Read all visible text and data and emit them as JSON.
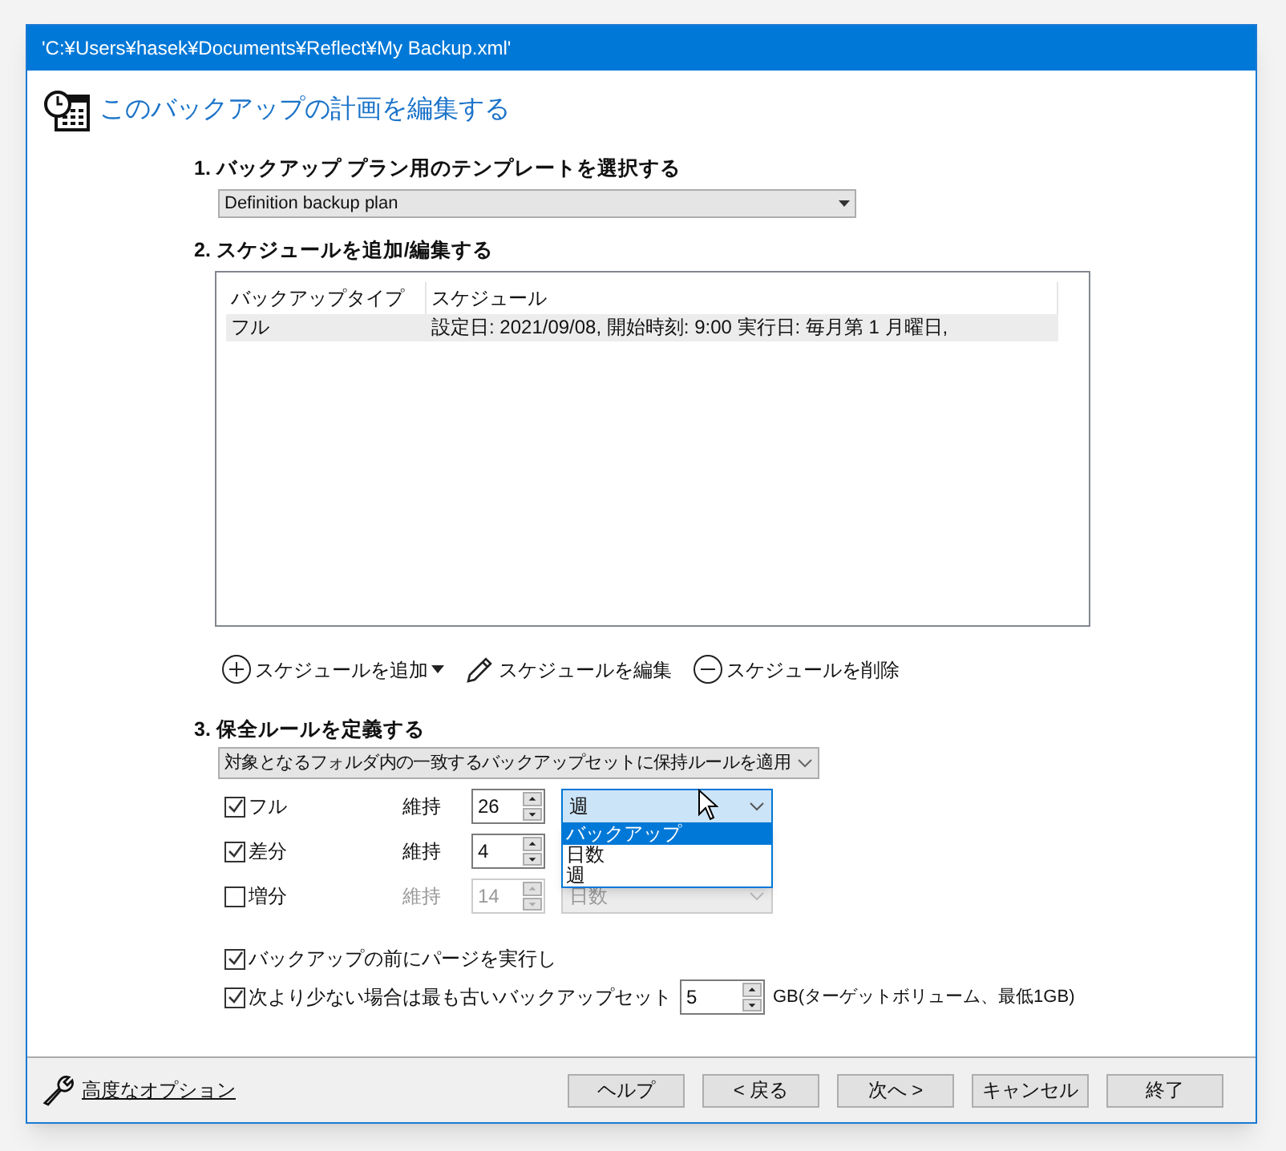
{
  "window": {
    "title": "'C:¥Users¥hasek¥Documents¥Reflect¥My Backup.xml'"
  },
  "heading": "このバックアップの計画を編集する",
  "section1": {
    "title": "1. バックアップ プラン用のテンプレートを選択する",
    "template": "Definition backup plan"
  },
  "section2": {
    "title": "2. スケジュールを追加/編集する",
    "table": {
      "columns": [
        "バックアップタイプ",
        "スケジュール"
      ],
      "rows": [
        {
          "cells": [
            "フル",
            "設定日: 2021/09/08, 開始時刻: 9:00  実行日: 毎月第 1 月曜日,"
          ],
          "selected": true
        }
      ]
    },
    "buttons": [
      {
        "kind": "add",
        "label": "スケジュールを追加"
      },
      {
        "kind": "edit",
        "label": "スケジュールを編集"
      },
      {
        "kind": "delete",
        "label": "スケジュールを削除"
      }
    ]
  },
  "section3": {
    "title": "3. 保全ルールを定義する",
    "policy": "対象となるフォルダ内の一致するバックアップセットに保持ルールを適用",
    "rules": [
      {
        "label": "フル",
        "checked": true,
        "keep": "維持",
        "count": "26",
        "unit": "週",
        "open": true,
        "options": [
          {
            "label": "バックアップ",
            "selected": true
          },
          {
            "label": "日数",
            "selected": false
          },
          {
            "label": "週",
            "selected": false
          }
        ]
      },
      {
        "label": "差分",
        "checked": true,
        "keep": "維持",
        "count": "4"
      },
      {
        "label": "増分",
        "checked": false,
        "keep": "維持",
        "count": "14",
        "unit": "日数",
        "open": false
      }
    ],
    "purge": {
      "label": "バックアップの前にパージを実行し",
      "checked": true
    },
    "space": {
      "label": "次より少ない場合は最も古いバックアップセット",
      "checked": true,
      "value": "5",
      "suffix": "GB(ターゲットボリューム、最低1GB)"
    }
  },
  "footer": {
    "link": "高度なオプション",
    "buttons": [
      "ヘルプ",
      "< 戻る",
      "次へ >",
      "キャンセル",
      "終了"
    ]
  }
}
